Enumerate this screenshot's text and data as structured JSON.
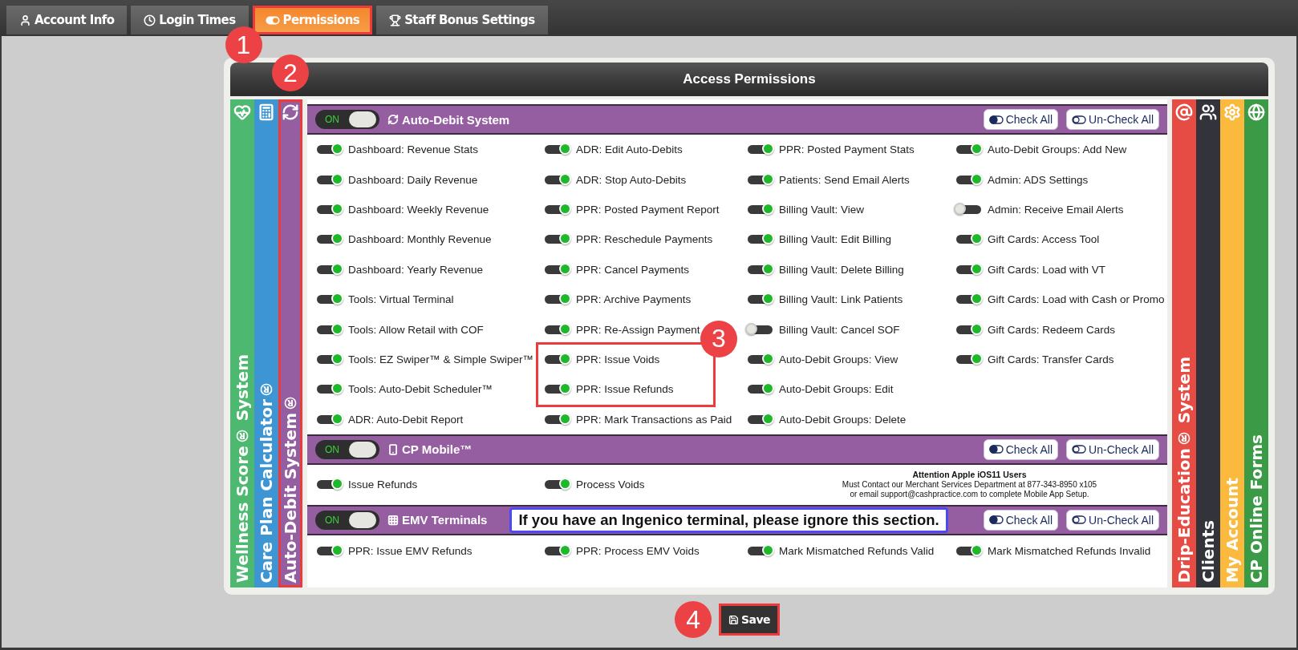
{
  "tabs": [
    {
      "label": "Account Info",
      "selected": false,
      "highlighted": false
    },
    {
      "label": "Login Times",
      "selected": false,
      "highlighted": false
    },
    {
      "label": "Permissions",
      "selected": true,
      "highlighted": true,
      "callout": "1"
    },
    {
      "label": "Staff Bonus Settings",
      "selected": false,
      "highlighted": false
    }
  ],
  "panel": {
    "title": "Access Permissions"
  },
  "left_tabs": [
    {
      "label": "Wellness Score® System",
      "color": "#4db870",
      "highlighted": false
    },
    {
      "label": "Care Plan Calculator®",
      "color": "#3d96d3",
      "highlighted": false
    },
    {
      "label": "Auto-Debit System®",
      "color": "#955ea0",
      "highlighted": true,
      "callout": "2"
    }
  ],
  "right_tabs": [
    {
      "label": "Drip-Education® System",
      "color": "#e64c43"
    },
    {
      "label": "Clients",
      "color": "#33333b"
    },
    {
      "label": "My Account",
      "color": "#fbb93e"
    },
    {
      "label": "CP Online Forms",
      "color": "#3b9a45"
    }
  ],
  "sections": [
    {
      "title": "Auto-Debit System",
      "switch_label": "ON",
      "on": true,
      "check_all": "Check All",
      "uncheck_all": "Un-Check All",
      "columns": [
        [
          {
            "label": "Dashboard: Revenue Stats",
            "on": true
          },
          {
            "label": "Dashboard: Daily Revenue",
            "on": true
          },
          {
            "label": "Dashboard: Weekly Revenue",
            "on": true
          },
          {
            "label": "Dashboard: Monthly Revenue",
            "on": true
          },
          {
            "label": "Dashboard: Yearly Revenue",
            "on": true
          },
          {
            "label": "Tools: Virtual Terminal",
            "on": true
          },
          {
            "label": "Tools: Allow Retail with COF",
            "on": true
          },
          {
            "label": "Tools: EZ Swiper™ & Simple Swiper™",
            "on": true
          },
          {
            "label": "Tools: Auto-Debit Scheduler™",
            "on": true
          },
          {
            "label": "ADR: Auto-Debit Report",
            "on": true
          }
        ],
        [
          {
            "label": "ADR: Edit Auto-Debits",
            "on": true
          },
          {
            "label": "ADR: Stop Auto-Debits",
            "on": true
          },
          {
            "label": "PPR: Posted Payment Report",
            "on": true
          },
          {
            "label": "PPR: Reschedule Payments",
            "on": true
          },
          {
            "label": "PPR: Cancel Payments",
            "on": true
          },
          {
            "label": "PPR: Archive Payments",
            "on": true
          },
          {
            "label": "PPR: Re-Assign Payment",
            "on": true
          },
          {
            "label": "PPR: Issue Voids",
            "on": true,
            "highlighted": true,
            "callout": "3"
          },
          {
            "label": "PPR: Issue Refunds",
            "on": true,
            "highlighted": true
          },
          {
            "label": "PPR: Mark Transactions as Paid",
            "on": true
          }
        ],
        [
          {
            "label": "PPR: Posted Payment Stats",
            "on": true
          },
          {
            "label": "Patients: Send Email Alerts",
            "on": true
          },
          {
            "label": "Billing Vault: View",
            "on": true
          },
          {
            "label": "Billing Vault: Edit Billing",
            "on": true
          },
          {
            "label": "Billing Vault: Delete Billing",
            "on": true
          },
          {
            "label": "Billing Vault: Link Patients",
            "on": true
          },
          {
            "label": "Billing Vault: Cancel SOF",
            "on": false
          },
          {
            "label": "Auto-Debit Groups: View",
            "on": true
          },
          {
            "label": "Auto-Debit Groups: Edit",
            "on": true
          },
          {
            "label": "Auto-Debit Groups: Delete",
            "on": true
          }
        ],
        [
          {
            "label": "Auto-Debit Groups: Add New",
            "on": true
          },
          {
            "label": "Admin: ADS Settings",
            "on": true
          },
          {
            "label": "Admin: Receive Email Alerts",
            "on": false
          },
          {
            "label": "Gift Cards: Access Tool",
            "on": true
          },
          {
            "label": "Gift Cards: Load with VT",
            "on": true
          },
          {
            "label": "Gift Cards: Load with Cash or Promo",
            "on": true
          },
          {
            "label": "Gift Cards: Redeem Cards",
            "on": true
          },
          {
            "label": "Gift Cards: Transfer Cards",
            "on": true
          }
        ]
      ]
    },
    {
      "title": "CP Mobile™",
      "switch_label": "ON",
      "on": true,
      "check_all": "Check All",
      "uncheck_all": "Un-Check All",
      "columns": [
        [
          {
            "label": "Issue Refunds",
            "on": true
          }
        ],
        [
          {
            "label": "Process Voids",
            "on": true
          }
        ]
      ],
      "notice": {
        "title": "Attention Apple iOS11 Users",
        "lines": [
          "Must Contact our Merchant Services Department at 877-343-8950 x105",
          "or email support@cashpractice.com to complete Mobile App Setup."
        ]
      }
    },
    {
      "title": "EMV Terminals",
      "switch_label": "ON",
      "on": true,
      "check_all": "Check All",
      "uncheck_all": "Un-Check All",
      "banner": "If you have an Ingenico terminal, please ignore this section.",
      "columns": [
        [
          {
            "label": "PPR: Issue EMV Refunds",
            "on": true
          }
        ],
        [
          {
            "label": "PPR: Process EMV Voids",
            "on": true
          }
        ],
        [
          {
            "label": "Mark Mismatched Refunds Valid",
            "on": true
          }
        ],
        [
          {
            "label": "Mark Mismatched Refunds Invalid",
            "on": true
          }
        ]
      ]
    }
  ],
  "save": {
    "label": "Save",
    "highlighted": true,
    "callout": "4"
  }
}
